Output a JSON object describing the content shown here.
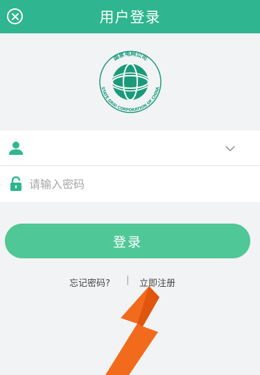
{
  "header": {
    "title": "用户登录",
    "close_icon": "circle-x-icon"
  },
  "logo": {
    "label_cn": "国家电网公司",
    "label_en": "STATE GRID CORPORATION OF CHINA",
    "brand_color": "#1a9a7a"
  },
  "form": {
    "username": {
      "value": "",
      "placeholder": "",
      "icon": "user-icon"
    },
    "password": {
      "value": "",
      "placeholder": "请输入密码",
      "icon": "lock-icon"
    },
    "dropdown_icon": "chevron-down-icon"
  },
  "login_button": {
    "label": "登录"
  },
  "links": {
    "forgot": "忘记密码?",
    "separator": "|",
    "register": "立即注册"
  },
  "annotation": {
    "icon": "arrow-pointer-icon",
    "color": "#f26b1d"
  },
  "colors": {
    "header": "#2fb58f",
    "button": "#4fc796",
    "background": "#f2f3f5"
  }
}
